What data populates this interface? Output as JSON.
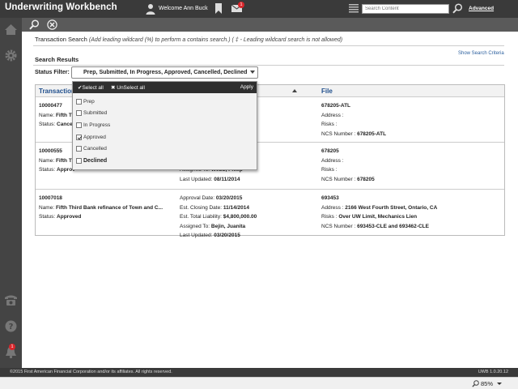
{
  "header": {
    "app_title": "Underwriting Workbench",
    "welcome_text": "Welcome Ann Buck",
    "mail_badge": "1",
    "search_placeholder": "Search Content",
    "advanced_label": "Advanced",
    "icons": [
      "user-icon",
      "bookmark-icon",
      "mail-icon",
      "list-icon",
      "search-icon"
    ]
  },
  "sidebar": {
    "icons": [
      "home-icon",
      "gear-icon",
      "phone-icon",
      "help-icon",
      "bell-icon"
    ],
    "notification_badge": "1"
  },
  "toolbar": {
    "icons": [
      "search-icon",
      "clear-icon"
    ]
  },
  "transaction_search": {
    "title": "Transaction Search",
    "hint": "(Add leading wildcard (%) to perform a contains search.) ( ‡ - Leading wildcard search is not allowed)"
  },
  "search_results": {
    "title": "Search Results",
    "show_criteria_label": "Show Search Criteria",
    "status_filter_label": "Status Filter:",
    "status_filter_value": "Prep, Submitted, In Progress, Approved, Cancelled, Declined",
    "columns": [
      "Transaction",
      "File"
    ]
  },
  "rows": [
    {
      "col1": [
        {
          "text": "10000477",
          "bold": true
        },
        {
          "label": "Name: ",
          "value": "Fifth Th"
        },
        {
          "label": "Status: ",
          "value": "Cancell"
        }
      ],
      "col2": [
        {
          "label": "",
          "value": ""
        },
        {
          "label": "",
          "value": ""
        },
        {
          "label": "",
          "value": "00"
        }
      ],
      "col3": [
        {
          "text": "678205-ATL",
          "bold": true
        },
        {
          "label": "Address : ",
          "value": ""
        },
        {
          "label": "Risks : ",
          "value": ""
        },
        {
          "label": "NCS Number : ",
          "value": "678205-ATL"
        }
      ]
    },
    {
      "col1": [
        {
          "text": "10000555",
          "bold": true
        },
        {
          "label": "Name: ",
          "value": "Fifth Th"
        },
        {
          "label": "Status: ",
          "value": "Approv"
        }
      ],
      "col2": [
        {
          "label": "Assigned To: ",
          "value": "Webb, Philip"
        },
        {
          "label": "Last Updated: ",
          "value": "08/11/2014"
        }
      ],
      "col3": [
        {
          "text": "678205",
          "bold": true
        },
        {
          "label": "Address : ",
          "value": ""
        },
        {
          "label": "Risks : ",
          "value": ""
        },
        {
          "label": "NCS Number : ",
          "value": "678205"
        }
      ]
    },
    {
      "col1": [
        {
          "text": "10007018",
          "bold": true
        },
        {
          "label": "Name: ",
          "value": "Fifth Third Bank refinance of Town and C..."
        },
        {
          "label": "Status: ",
          "value": "Approved"
        }
      ],
      "col2": [
        {
          "label": "Approval Date: ",
          "value": "03/20/2015"
        },
        {
          "label": "Est. Closing Date: ",
          "value": "11/14/2014"
        },
        {
          "label": "Est. Total Liability: ",
          "value": "$4,800,000.00"
        },
        {
          "label": "Assigned To: ",
          "value": "Bejin, Juanita"
        },
        {
          "label": "Last Updated: ",
          "value": "03/20/2015"
        }
      ],
      "col3": [
        {
          "text": "693453",
          "bold": true
        },
        {
          "label": "Address : ",
          "value": "2166 West Fourth Street, Ontario, CA"
        },
        {
          "label": "Risks : ",
          "value": "Over UW Limit, Mechanics Lien"
        },
        {
          "label": "NCS Number : ",
          "value": "693453-CLE and 693462-CLE"
        }
      ]
    }
  ],
  "status_dropdown": {
    "select_all_label": "✔Select all",
    "unselect_all_label": "✖ UnSelect all",
    "apply_label": "Apply",
    "options": [
      {
        "label": "Prep",
        "checked": false
      },
      {
        "label": "Submitted",
        "checked": false
      },
      {
        "label": "In Progress",
        "checked": false
      },
      {
        "label": "Approved",
        "checked": true
      },
      {
        "label": "Cancelled",
        "checked": false
      },
      {
        "label": "Declined",
        "checked": false
      }
    ]
  },
  "footer": {
    "copyright": "©2015 First American Financial Corporation and/or its affiliates. All rights reserved.",
    "version": "UWB 1.0.20.12"
  },
  "status_bar": {
    "zoom_level": "85%"
  }
}
